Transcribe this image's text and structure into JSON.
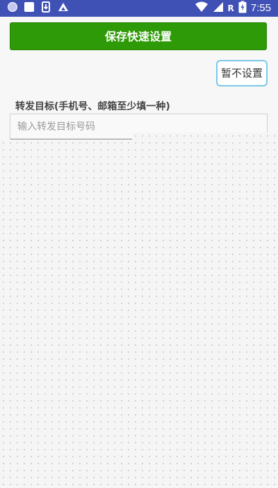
{
  "status_bar": {
    "time": "7:55",
    "network_label": "R",
    "left_icons": [
      "circle-icon",
      "square-icon",
      "download-icon",
      "cloud-icon"
    ],
    "right_icons": [
      "wifi-icon",
      "signal-icon",
      "battery-icon"
    ],
    "bg_color": "#3f51b5"
  },
  "actions": {
    "save_label": "保存快速设置",
    "skip_label": "暂不设置"
  },
  "form": {
    "target_label": "转发目标(手机号、邮箱至少填一种)",
    "target_placeholder": "输入转发目标号码",
    "target_value": ""
  },
  "colors": {
    "save_button": "#2e9a07",
    "skip_border": "#7cc7e6"
  }
}
